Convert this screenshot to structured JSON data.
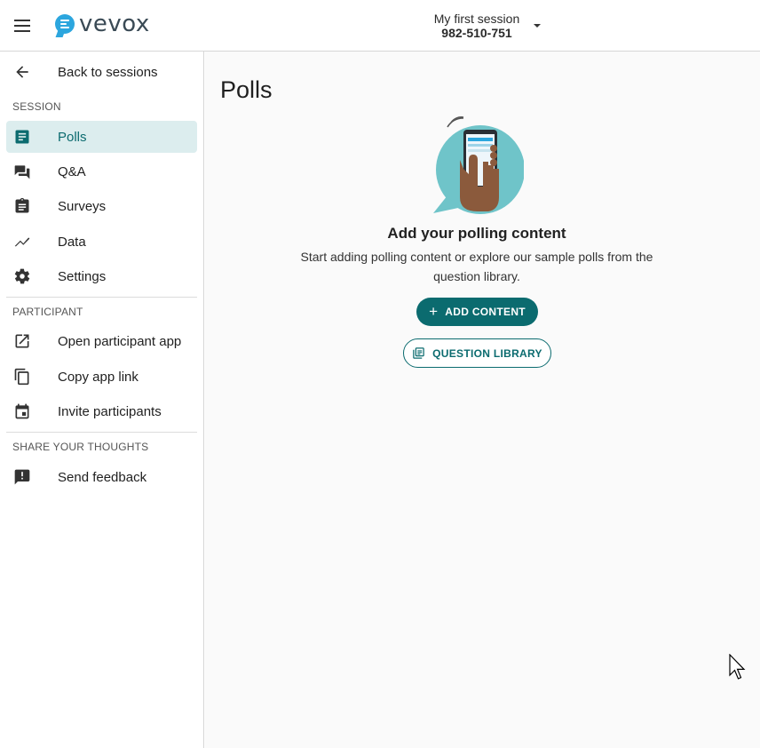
{
  "header": {
    "brand": "vevox",
    "session_name": "My first session",
    "session_code": "982-510-751"
  },
  "sidebar": {
    "back_label": "Back to sessions",
    "sections": {
      "session": "SESSION",
      "participant": "PARTICIPANT",
      "share": "SHARE YOUR THOUGHTS"
    },
    "session_items": [
      {
        "label": "Polls",
        "icon": "polls-icon",
        "active": true
      },
      {
        "label": "Q&A",
        "icon": "qa-icon"
      },
      {
        "label": "Surveys",
        "icon": "surveys-icon"
      },
      {
        "label": "Data",
        "icon": "data-icon"
      },
      {
        "label": "Settings",
        "icon": "gear-icon"
      }
    ],
    "participant_items": [
      {
        "label": "Open participant app",
        "icon": "open-external-icon"
      },
      {
        "label": "Copy app link",
        "icon": "copy-icon"
      },
      {
        "label": "Invite participants",
        "icon": "calendar-icon"
      }
    ],
    "share_items": [
      {
        "label": "Send feedback",
        "icon": "feedback-icon"
      }
    ]
  },
  "main": {
    "title": "Polls",
    "empty_title": "Add your polling content",
    "empty_desc": "Start adding polling content or explore our sample polls from the question library.",
    "add_content": "ADD CONTENT",
    "question_library": "QUESTION LIBRARY"
  },
  "colors": {
    "accent": "#0b6b6f",
    "active_bg": "#dcedee",
    "brand_blue": "#2ca6de",
    "hero_teal": "#6fc4c9"
  }
}
